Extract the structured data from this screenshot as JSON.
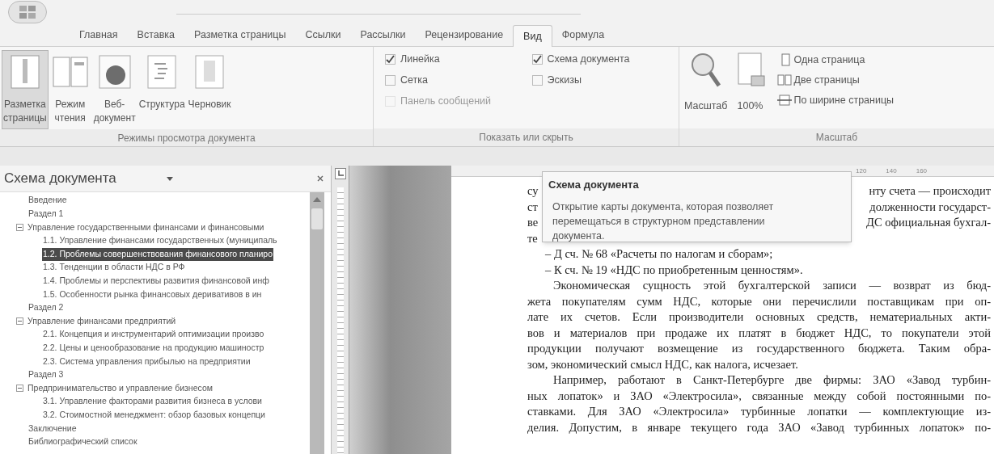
{
  "tabs": [
    {
      "label": "Главная",
      "selected": false
    },
    {
      "label": "Вставка",
      "selected": false
    },
    {
      "label": "Разметка страницы",
      "selected": false
    },
    {
      "label": "Ссылки",
      "selected": false
    },
    {
      "label": "Рассылки",
      "selected": false
    },
    {
      "label": "Рецензирование",
      "selected": false
    },
    {
      "label": "Вид",
      "selected": true
    },
    {
      "label": "Формула",
      "selected": false
    }
  ],
  "view_group": {
    "label": "Режимы просмотра документа",
    "buttons": [
      {
        "label": "Разметка страницы",
        "selected": true
      },
      {
        "label": "Режим чтения",
        "selected": false
      },
      {
        "label": "Веб-документ",
        "selected": false
      },
      {
        "label": "Структура",
        "selected": false
      },
      {
        "label": "Черновик",
        "selected": false
      }
    ]
  },
  "show_group": {
    "label": "Показать или скрыть",
    "options": [
      {
        "label": "Линейка",
        "checked": true,
        "disabled": false
      },
      {
        "label": "Сетка",
        "checked": false,
        "disabled": false
      },
      {
        "label": "Панель сообщений",
        "checked": false,
        "disabled": true
      },
      {
        "label": "Схема документа",
        "checked": true,
        "disabled": false
      },
      {
        "label": "Эскизы",
        "checked": false,
        "disabled": false
      }
    ]
  },
  "zoom_group": {
    "label": "Масштаб",
    "large_buttons": [
      "Масштаб",
      "100%"
    ],
    "small_buttons": [
      "Одна страница",
      "Две страницы",
      "По ширине страницы"
    ]
  },
  "nav_pane": {
    "title": "Схема документа",
    "items": [
      {
        "label": "Введение",
        "selected": false
      },
      {
        "label": "Раздел 1",
        "selected": false
      },
      {
        "label": "Управление государственными финансами и финансовыми",
        "selected": false,
        "expanded": true,
        "children": [
          {
            "label": "1.1. Управление финансами государственных (муниципаль",
            "selected": false
          },
          {
            "label": "1.2. Проблемы совершенствования финансового планиро",
            "selected": true
          },
          {
            "label": "1.3. Тенденции в области НДС в РФ",
            "selected": false
          },
          {
            "label": "1.4. Проблемы и перспективы развития финансовой инф",
            "selected": false
          },
          {
            "label": "1.5. Особенности рынка финансовых деривативов в ин",
            "selected": false
          }
        ]
      },
      {
        "label": "Раздел 2",
        "selected": false
      },
      {
        "label": "Управление финансами предприятий",
        "selected": false,
        "expanded": true,
        "children": [
          {
            "label": "2.1. Концепция и инструментарий оптимизации произво",
            "selected": false
          },
          {
            "label": "2.2. Цены и ценообразование на продукцию машиностр",
            "selected": false
          },
          {
            "label": "2.3. Система управления прибылью на предприятии",
            "selected": false
          }
        ]
      },
      {
        "label": "Раздел 3",
        "selected": false
      },
      {
        "label": "Предпринимательство и управление бизнесом",
        "selected": false,
        "expanded": true,
        "children": [
          {
            "label": "3.1. Управление факторами развития бизнеса в услови",
            "selected": false
          },
          {
            "label": "3.2. Стоимостной менеджмент: обзор базовых концепци",
            "selected": false
          }
        ]
      },
      {
        "label": "Заключение",
        "selected": false
      },
      {
        "label": "Библиографический список",
        "selected": false
      }
    ]
  },
  "ruler_labels": [
    "120",
    "140",
    "160"
  ],
  "document": {
    "split_lines": [
      {
        "left": "су",
        "right": "нту счета — происходит"
      },
      {
        "left": "ст",
        "right": "долженности государст-"
      },
      {
        "left": "ве",
        "right": "ДС официальная бухгал-"
      },
      {
        "left": "те"
      }
    ],
    "lines": [
      {
        "kind": "item",
        "text": "– Д сч. № 68 «Расчеты по налогам и сборам»;"
      },
      {
        "kind": "item",
        "text": "– К сч. № 19 «НДС по приобретенным ценностям»."
      },
      {
        "kind": "first",
        "text": "Экономическая сущность этой бухгалтерской записи — возврат из бюд-"
      },
      {
        "kind": "body",
        "text": "жета покупателям сумм НДС, которые они перечислили поставщикам при оп-"
      },
      {
        "kind": "body",
        "text": "лате их счетов. Если производители основных средств, нематериальных акти-"
      },
      {
        "kind": "body",
        "text": "вов и материалов при продаже их платят в бюджет НДС, то покупатели этой"
      },
      {
        "kind": "body",
        "text": "продукции получают возмещение из государственного бюджета. Таким обра-"
      },
      {
        "kind": "last",
        "text": "зом, экономический смысл НДС, как налога, исчезает."
      },
      {
        "kind": "first",
        "text": "Например, работают в Санкт-Петербурге две фирмы: ЗАО «Завод турбин-"
      },
      {
        "kind": "body",
        "text": "ных лопаток» и ЗАО «Электросила», связанные между собой постоянными по-"
      },
      {
        "kind": "body",
        "text": "ставками. Для ЗАО «Электросила» турбинные лопатки — комплектующие из-"
      },
      {
        "kind": "body",
        "text": "делия. Допустим, в январе текущего года ЗАО «Завод турбинных лопаток» по-"
      }
    ]
  },
  "tooltip": {
    "title": "Схема документа",
    "body": "Открытие карты документа, которая позволяет перемещаться в структурном представлении документа."
  }
}
